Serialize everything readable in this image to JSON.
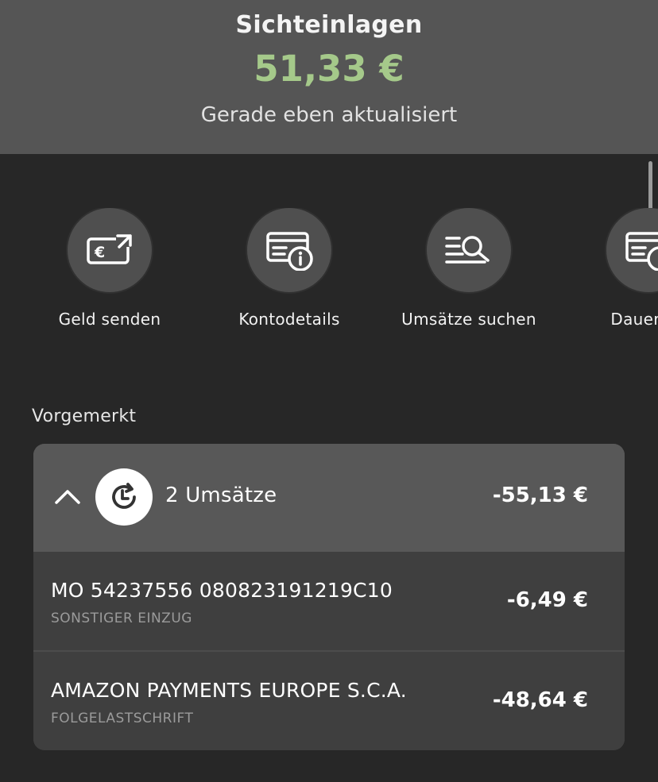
{
  "header": {
    "title": "Sichteinlagen",
    "balance": "51,33 €",
    "updated": "Gerade eben aktualisiert"
  },
  "colors": {
    "balance": "#a5c98a",
    "background": "#272727",
    "header": "#555555"
  },
  "actions": [
    {
      "label": "Geld senden",
      "icon": "euro-send-icon"
    },
    {
      "label": "Kontodetails",
      "icon": "account-info-icon"
    },
    {
      "label": "Umsätze suchen",
      "icon": "search-list-icon"
    },
    {
      "label": "Dauerauf",
      "icon": "standing-order-icon"
    }
  ],
  "pending": {
    "section_label": "Vorgemerkt",
    "summary": {
      "count_label": "2 Umsätze",
      "total": "-55,13 €"
    },
    "transactions": [
      {
        "name": "MO 54237556 080823191219C10",
        "type": "SONSTIGER EINZUG",
        "amount": "-6,49 €"
      },
      {
        "name": "AMAZON PAYMENTS EUROPE S.C.A.",
        "type": "FOLGELASTSCHRIFT",
        "amount": "-48,64 €"
      }
    ]
  }
}
